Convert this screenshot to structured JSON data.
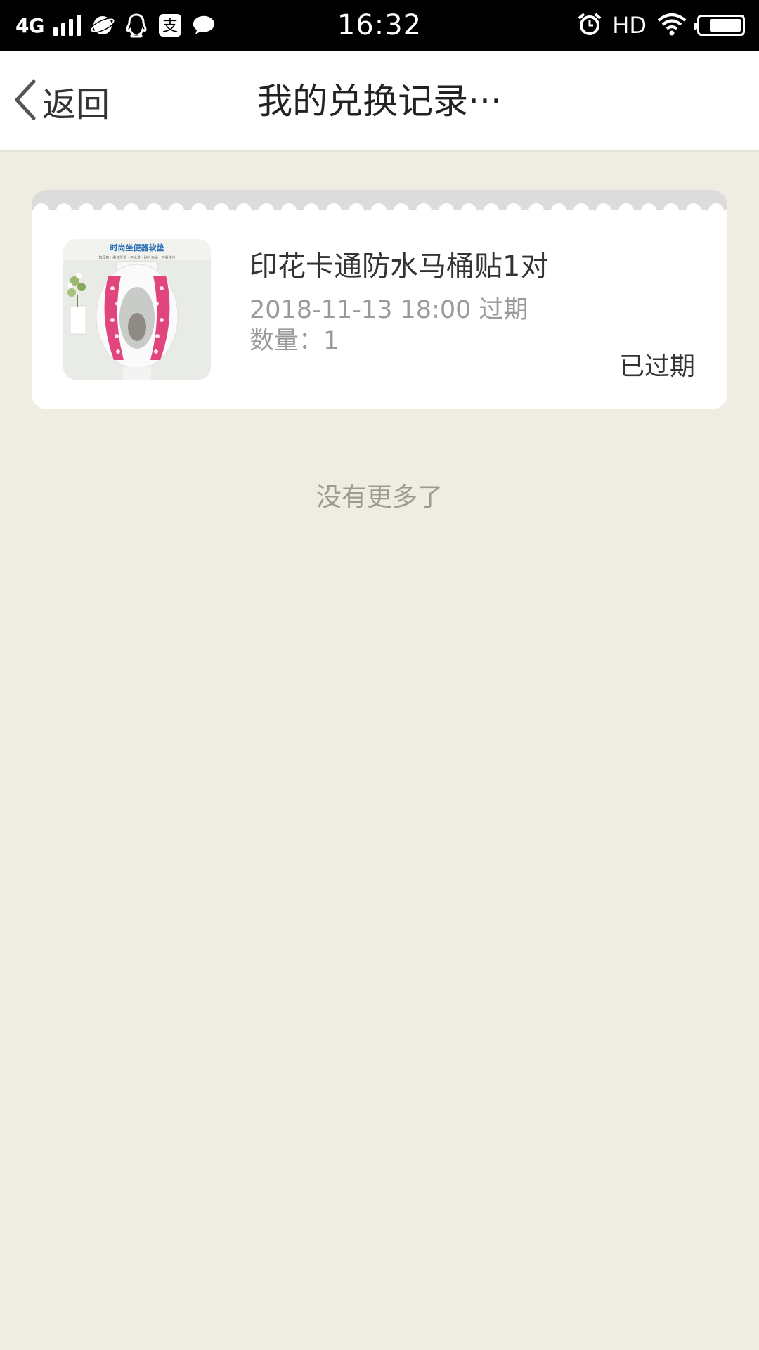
{
  "status_bar": {
    "network": "4G",
    "time": "16:32",
    "hd": "HD",
    "icons": [
      "signal-icon",
      "browser-app-icon",
      "qq-app-icon",
      "alipay-app-icon",
      "chat-app-icon",
      "alarm-icon",
      "wifi-icon",
      "battery-icon"
    ]
  },
  "nav": {
    "back_label": "返回",
    "title": "我的兑换记录···"
  },
  "records": [
    {
      "title": "印花卡通防水马桶贴1对",
      "expiry": "2018-11-13 18:00 过期",
      "quantity": "数量：1",
      "status": "已过期",
      "thumb_caption": "时尚坐便器软垫",
      "thumb_subcaption": "加厚款 · 柔软舒适 · 可水洗 · 贴合马桶 · 不易移位"
    }
  ],
  "footer": {
    "no_more": "没有更多了"
  },
  "colors": {
    "page_bg": "#efede1",
    "status_bar_bg": "#000000",
    "card_bg": "#ffffff",
    "scallop": "#dcdcdc",
    "muted_text": "#9a9a9a"
  }
}
